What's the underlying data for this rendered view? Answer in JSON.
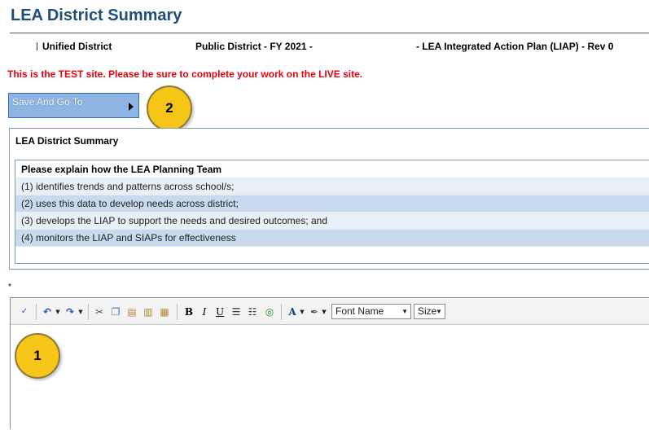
{
  "page": {
    "title": "LEA District Summary",
    "warning": "This is the TEST site. Please be sure to complete your work on the LIVE site."
  },
  "info_bar": {
    "district": "Unified District",
    "fiscal": "Public District - FY 2021 -",
    "plan": "- LEA Integrated Action Plan (LIAP) - Rev 0"
  },
  "save_button": {
    "label": "Save And Go To",
    "icon": "play-arrow-icon"
  },
  "callouts": {
    "first": "1",
    "second": "2"
  },
  "panel": {
    "header": "LEA District Summary",
    "prompt_header": "Please explain how the LEA Planning Team",
    "prompts": [
      "(1) identifies trends and patterns across school/s;",
      "(2) uses this data to develop needs across district;",
      "(3) develops the LIAP to support the needs and desired outcomes; and",
      "(4) monitors the LIAP and SIAPs for effectiveness"
    ]
  },
  "required_marker": "*",
  "editor": {
    "font_name": "Font Name",
    "font_size": "Size",
    "content": "",
    "toolbar_icons": [
      "spellcheck-icon",
      "undo-icon",
      "redo-icon",
      "cut-icon",
      "copy-icon",
      "paste-icon",
      "paste-text-icon",
      "paste-word-icon",
      "bold-icon",
      "italic-icon",
      "underline-icon",
      "ordered-list-icon",
      "unordered-list-icon",
      "insert-link-icon",
      "font-color-icon",
      "highlight-color-icon"
    ]
  },
  "colors": {
    "title": "#1f4e79",
    "warning": "#e8000b",
    "button": "#8db4e2",
    "callout": "#f5c518",
    "row_light": "#e9eff7",
    "row_dark": "#c8daee"
  }
}
